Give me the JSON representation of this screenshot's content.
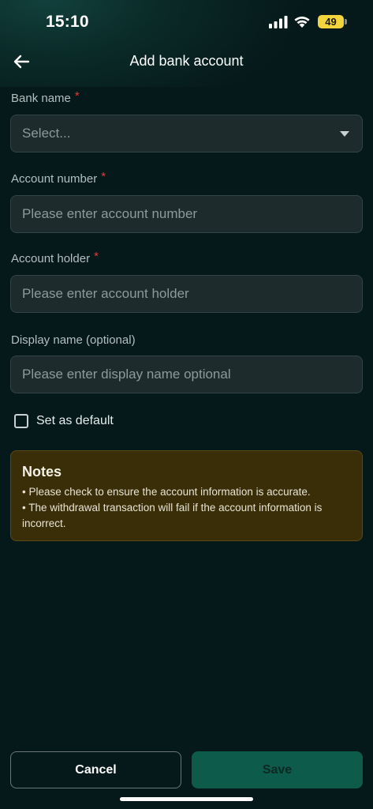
{
  "status_bar": {
    "time": "15:10",
    "battery": "49"
  },
  "header": {
    "title": "Add bank account"
  },
  "form": {
    "bank_name": {
      "label": "Bank name",
      "required_mark": "*",
      "value": "Select..."
    },
    "account_number": {
      "label": "Account number",
      "required_mark": "*",
      "placeholder": "Please enter account number"
    },
    "account_holder": {
      "label": "Account holder",
      "required_mark": "*",
      "placeholder": "Please enter account holder"
    },
    "display_name": {
      "label": "Display name (optional)",
      "placeholder": "Please enter display name optional"
    },
    "default_checkbox": {
      "label": "Set as default",
      "checked": false
    }
  },
  "notes": {
    "title": "Notes",
    "lines": [
      "• Please check to ensure the account information is accurate.",
      "• The withdrawal transaction will fail if the account information is incorrect."
    ]
  },
  "actions": {
    "cancel_label": "Cancel",
    "save_label": "Save"
  },
  "colors": {
    "background": "#06191a",
    "field": "#1d2b2c",
    "required": "#e53935",
    "save": "#0d5b4b",
    "notes_bg": "#3a2e08",
    "battery": "#f2d43d"
  },
  "icons": {
    "back": "arrow-left-icon",
    "dropdown": "chevron-down-icon"
  }
}
